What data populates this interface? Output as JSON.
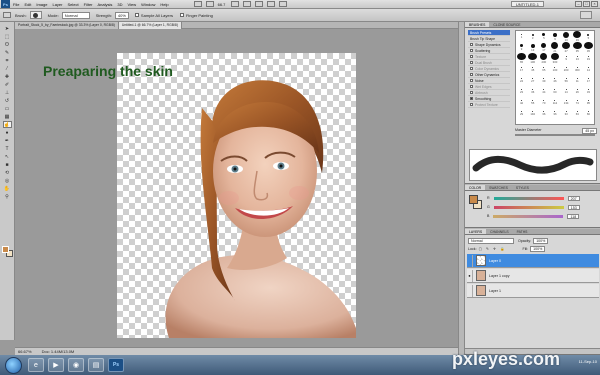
{
  "app": {
    "logo": "Ps",
    "zoom": "66.7",
    "workspace": "UNTITLED-1"
  },
  "menu": [
    "File",
    "Edit",
    "Image",
    "Layer",
    "Select",
    "Filter",
    "Analysis",
    "3D",
    "View",
    "Window",
    "Help"
  ],
  "options": {
    "brush_label": "Brush:",
    "mode_label": "Mode:",
    "mode_value": "Normal",
    "strength_label": "Strength:",
    "strength_value": "40%",
    "sample_all": "Sample All Layers",
    "finger_painting": "Finger Painting"
  },
  "tabs": [
    "Portrait_Stock_5_by_Faeriestock.jpg @ 33.3% (Layer 0, RGB/8)",
    "Untitled-1 @ 66.7% (Layer 1, RGB/8)"
  ],
  "caption": "Preaparing the skin",
  "status": {
    "zoom": "66.67%",
    "doc": "Doc: 1.44M/13.0M"
  },
  "panels": {
    "brushes": {
      "tabs": [
        "BRUSHES",
        "CLONE SOURCE"
      ],
      "items": [
        {
          "label": "Brush Presets",
          "sel": true
        },
        {
          "label": "Brush Tip Shape"
        },
        {
          "label": "Shape Dynamics",
          "check": false
        },
        {
          "label": "Scattering",
          "check": false
        },
        {
          "label": "Texture",
          "check": false,
          "dim": true
        },
        {
          "label": "Dual Brush",
          "check": false,
          "dim": true
        },
        {
          "label": "Color Dynamics",
          "check": false,
          "dim": true
        },
        {
          "label": "Other Dynamics",
          "check": false
        },
        {
          "label": "Noise",
          "check": false
        },
        {
          "label": "Wet Edges",
          "check": false,
          "dim": true
        },
        {
          "label": "Airbrush",
          "check": false,
          "dim": true
        },
        {
          "label": "Smoothing",
          "check": true
        },
        {
          "label": "Protect Texture",
          "check": false,
          "dim": true
        }
      ],
      "presets": [
        {
          "s": 1,
          "n": "1"
        },
        {
          "s": 2,
          "n": "3"
        },
        {
          "s": 3,
          "n": "5"
        },
        {
          "s": 4,
          "n": "9"
        },
        {
          "s": 6,
          "n": "13"
        },
        {
          "s": 8,
          "n": "19"
        },
        {
          "s": 2,
          "n": "5"
        },
        {
          "s": 3,
          "n": "9"
        },
        {
          "s": 4,
          "n": "13"
        },
        {
          "s": 5,
          "n": "17"
        },
        {
          "s": 7,
          "n": "21"
        },
        {
          "s": 8,
          "n": "27"
        },
        {
          "s": 9,
          "n": "35"
        },
        {
          "s": 9,
          "n": "45"
        },
        {
          "s": 9,
          "n": "65"
        },
        {
          "s": 9,
          "n": "100"
        },
        {
          "s": 7,
          "n": "200"
        },
        {
          "s": 8,
          "n": "300"
        },
        {
          "s": 1,
          "n": "9"
        },
        {
          "s": 1,
          "n": "13"
        },
        {
          "s": 1,
          "n": "19"
        },
        {
          "s": 1,
          "n": "17"
        },
        {
          "s": 1,
          "n": "45"
        },
        {
          "s": 1,
          "n": "65"
        },
        {
          "s": 1,
          "n": "100"
        },
        {
          "s": 1,
          "n": "200"
        },
        {
          "s": 1,
          "n": "300"
        },
        {
          "s": 1,
          "n": "14"
        },
        {
          "s": 1,
          "n": "24"
        },
        {
          "s": 1,
          "n": "27"
        },
        {
          "s": 1,
          "n": "39"
        },
        {
          "s": 1,
          "n": "46"
        },
        {
          "s": 1,
          "n": "59"
        },
        {
          "s": 1,
          "n": "11"
        },
        {
          "s": 1,
          "n": "17"
        },
        {
          "s": 1,
          "n": "23"
        },
        {
          "s": 1,
          "n": "36"
        },
        {
          "s": 1,
          "n": "44"
        },
        {
          "s": 1,
          "n": "60"
        },
        {
          "s": 1,
          "n": "14"
        },
        {
          "s": 1,
          "n": "26"
        },
        {
          "s": 1,
          "n": "33"
        },
        {
          "s": 1,
          "n": "42"
        },
        {
          "s": 1,
          "n": "55"
        },
        {
          "s": 1,
          "n": "70"
        },
        {
          "s": 1,
          "n": "112"
        },
        {
          "s": 1,
          "n": "134"
        },
        {
          "s": 1,
          "n": "74"
        },
        {
          "s": 1,
          "n": "95"
        },
        {
          "s": 1,
          "n": "29"
        },
        {
          "s": 1,
          "n": "192"
        },
        {
          "s": 1,
          "n": "36"
        },
        {
          "s": 1,
          "n": "36"
        },
        {
          "s": 1,
          "n": "33"
        },
        {
          "s": 1,
          "n": "63"
        },
        {
          "s": 1,
          "n": "66"
        }
      ],
      "diameter_label": "Master Diameter",
      "diameter_value": "45 px"
    },
    "color": {
      "tabs": [
        "COLOR",
        "SWATCHES",
        "STYLES"
      ],
      "rows": [
        {
          "label": "R",
          "value": "207"
        },
        {
          "label": "G",
          "value": "153"
        },
        {
          "label": "B",
          "value": "118"
        }
      ],
      "fg": "#c98a4a",
      "bg": "#f2e2c4"
    },
    "layers": {
      "tabs": [
        "LAYERS",
        "CHANNELS",
        "PATHS"
      ],
      "blend": "Normal",
      "opacity_label": "Opacity:",
      "opacity_value": "100%",
      "lock_label": "Lock:",
      "fill_label": "Fill:",
      "fill_value": "100%",
      "list": [
        {
          "name": "Layer 0",
          "selected": true,
          "visible": false,
          "photo": false
        },
        {
          "name": "Layer 1 copy",
          "selected": false,
          "visible": true,
          "photo": true
        },
        {
          "name": "Layer 1",
          "selected": false,
          "visible": false,
          "photo": true
        }
      ]
    }
  },
  "watermark": "pxleyes.com",
  "clock": {
    "time": "",
    "date": "11-Sep-10"
  }
}
